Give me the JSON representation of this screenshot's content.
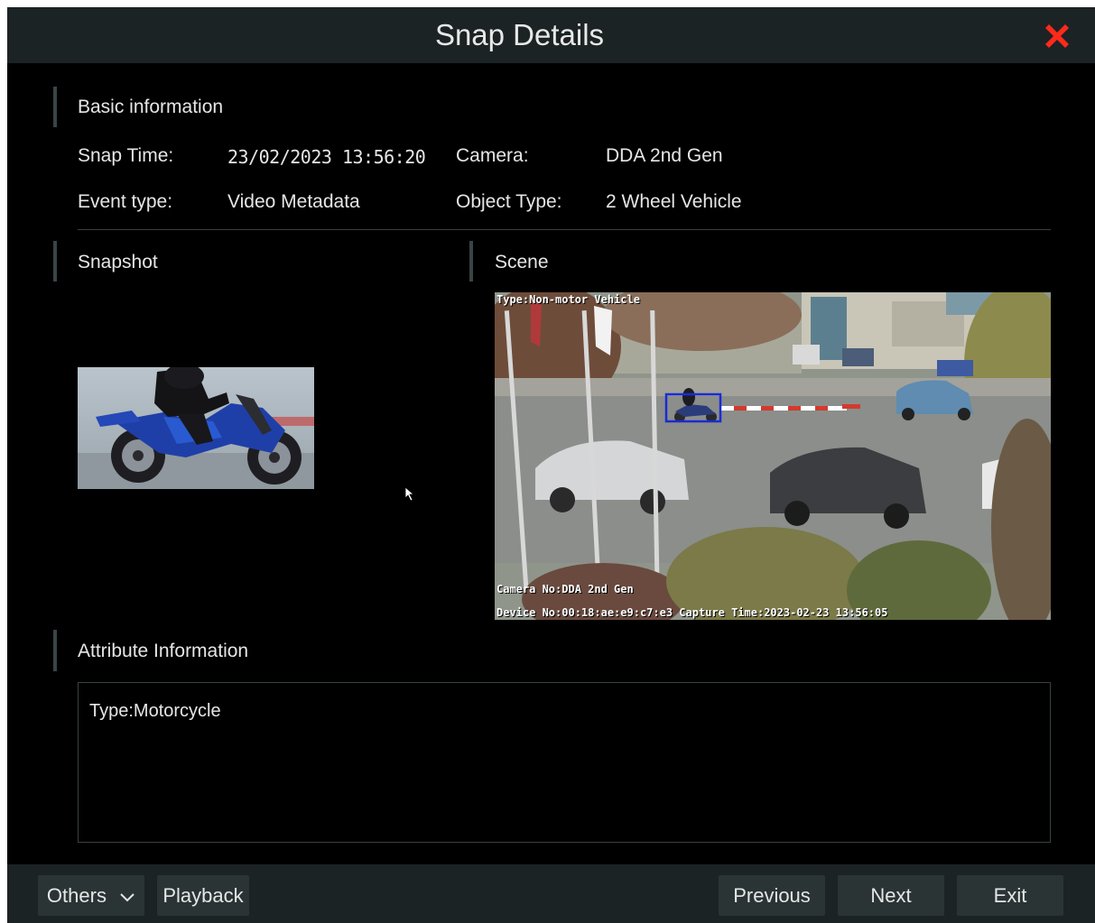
{
  "dialog": {
    "title": "Snap Details",
    "close_icon": "close-icon",
    "accent_close": "#ff2a1a"
  },
  "basic": {
    "section_title": "Basic information",
    "snap_time_label": "Snap Time:",
    "snap_time_value": "23/02/2023 13:56:20",
    "camera_label": "Camera:",
    "camera_value": "DDA 2nd Gen",
    "event_type_label": "Event type:",
    "event_type_value": "Video Metadata",
    "object_type_label": "Object Type:",
    "object_type_value": "2 Wheel Vehicle"
  },
  "snapshot": {
    "section_title": "Snapshot"
  },
  "scene": {
    "section_title": "Scene",
    "overlay_type": "Type:Non-motor Vehicle",
    "overlay_camera": "Camera No:DDA 2nd Gen",
    "overlay_device": "Device No:00:18:ae:e9:c7:e3 Capture Time:2023-02-23 13:56:05",
    "detection_box_color": "#1a2bd6"
  },
  "attributes": {
    "section_title": "Attribute Information",
    "text": "Type:Motorcycle"
  },
  "footer": {
    "others_label": "Others",
    "others_icon": "chevron-down-icon",
    "playback_label": "Playback",
    "previous_label": "Previous",
    "next_label": "Next",
    "exit_label": "Exit"
  }
}
